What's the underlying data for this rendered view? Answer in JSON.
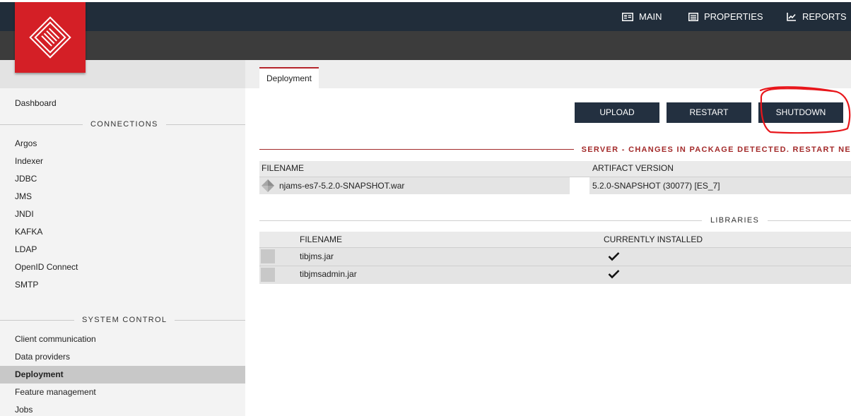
{
  "header": {
    "nav": [
      {
        "label": "MAIN",
        "icon": "main-icon"
      },
      {
        "label": "PROPERTIES",
        "icon": "properties-icon"
      },
      {
        "label": "REPORTS",
        "icon": "reports-icon"
      }
    ],
    "brand_color": "#d41f26"
  },
  "sidebar": {
    "top_items": [
      "Dashboard"
    ],
    "connections_title": "CONNECTIONS",
    "connections": [
      "Argos",
      "Indexer",
      "JDBC",
      "JMS",
      "JNDI",
      "KAFKA",
      "LDAP",
      "OpenID Connect",
      "SMTP"
    ],
    "system_title": "SYSTEM CONTROL",
    "system": [
      "Client communication",
      "Data providers",
      "Deployment",
      "Feature management",
      "Jobs"
    ],
    "active": "Deployment"
  },
  "content": {
    "tab": "Deployment",
    "buttons": {
      "upload": "UPLOAD",
      "restart": "RESTART",
      "shutdown": "SHUTDOWN"
    },
    "alert": "SERVER - CHANGES IN PACKAGE DETECTED. RESTART NE",
    "package_table": {
      "columns": [
        "FILENAME",
        "ARTIFACT VERSION"
      ],
      "rows": [
        {
          "filename": "njams-es7-5.2.0-SNAPSHOT.war",
          "version": "5.2.0-SNAPSHOT (30077) [ES_7]"
        }
      ]
    },
    "libraries_title": "LIBRARIES",
    "libraries_table": {
      "columns": [
        "FILENAME",
        "CURRENTLY INSTALLED"
      ],
      "rows": [
        {
          "filename": "tibjms.jar",
          "installed": "check-icon"
        },
        {
          "filename": "tibjmsadmin.jar",
          "installed": "check-icon"
        }
      ]
    }
  }
}
